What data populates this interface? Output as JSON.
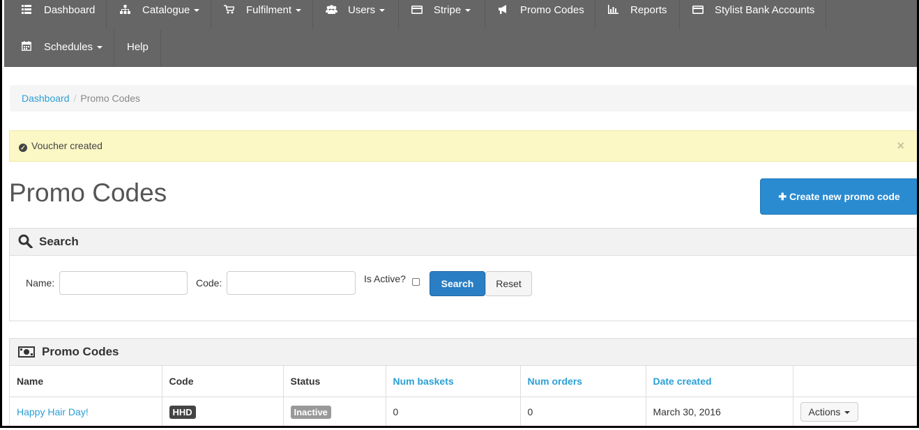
{
  "navbar": {
    "row1": [
      {
        "label": "Dashboard",
        "icon": "list-icon",
        "dropdown": false
      },
      {
        "label": "Catalogue",
        "icon": "sitemap-icon",
        "dropdown": true
      },
      {
        "label": "Fulfilment",
        "icon": "cart-icon",
        "dropdown": true
      },
      {
        "label": "Users",
        "icon": "users-icon",
        "dropdown": true
      },
      {
        "label": "Stripe",
        "icon": "credit-card-icon",
        "dropdown": true
      },
      {
        "label": "Promo Codes",
        "icon": "bullhorn-icon",
        "dropdown": false
      },
      {
        "label": "Reports",
        "icon": "bar-chart-icon",
        "dropdown": false
      },
      {
        "label": "Stylist Bank Accounts",
        "icon": "credit-card-icon",
        "dropdown": false
      }
    ],
    "row2": [
      {
        "label": "Schedules",
        "icon": "calendar-icon",
        "dropdown": true
      },
      {
        "label": "Help",
        "icon": "",
        "dropdown": false
      }
    ]
  },
  "breadcrumb": {
    "home": "Dashboard",
    "separator": "/",
    "current": "Promo Codes"
  },
  "alert": {
    "message": "Voucher created",
    "close": "×",
    "color": "#fcf8c5"
  },
  "page_title": "Promo Codes",
  "create_button": "Create new promo code",
  "search": {
    "heading": "Search",
    "name_label": "Name:",
    "name_value": "",
    "code_label": "Code:",
    "code_value": "",
    "active_label": "Is Active?",
    "active_checked": false,
    "search_button": "Search",
    "reset_button": "Reset"
  },
  "results": {
    "heading": "Promo Codes",
    "columns": [
      "Name",
      "Code",
      "Status",
      "Num baskets",
      "Num orders",
      "Date created",
      ""
    ],
    "rows": [
      {
        "name": "Happy Hair Day!",
        "code": "HHD",
        "status": "Inactive",
        "num_baskets": "0",
        "num_orders": "0",
        "date_created": "March 30, 2016",
        "actions": "Actions"
      }
    ]
  },
  "colors": {
    "navbar": "#666666",
    "link": "#2a9fd6",
    "primary": "#2a8bd1"
  }
}
